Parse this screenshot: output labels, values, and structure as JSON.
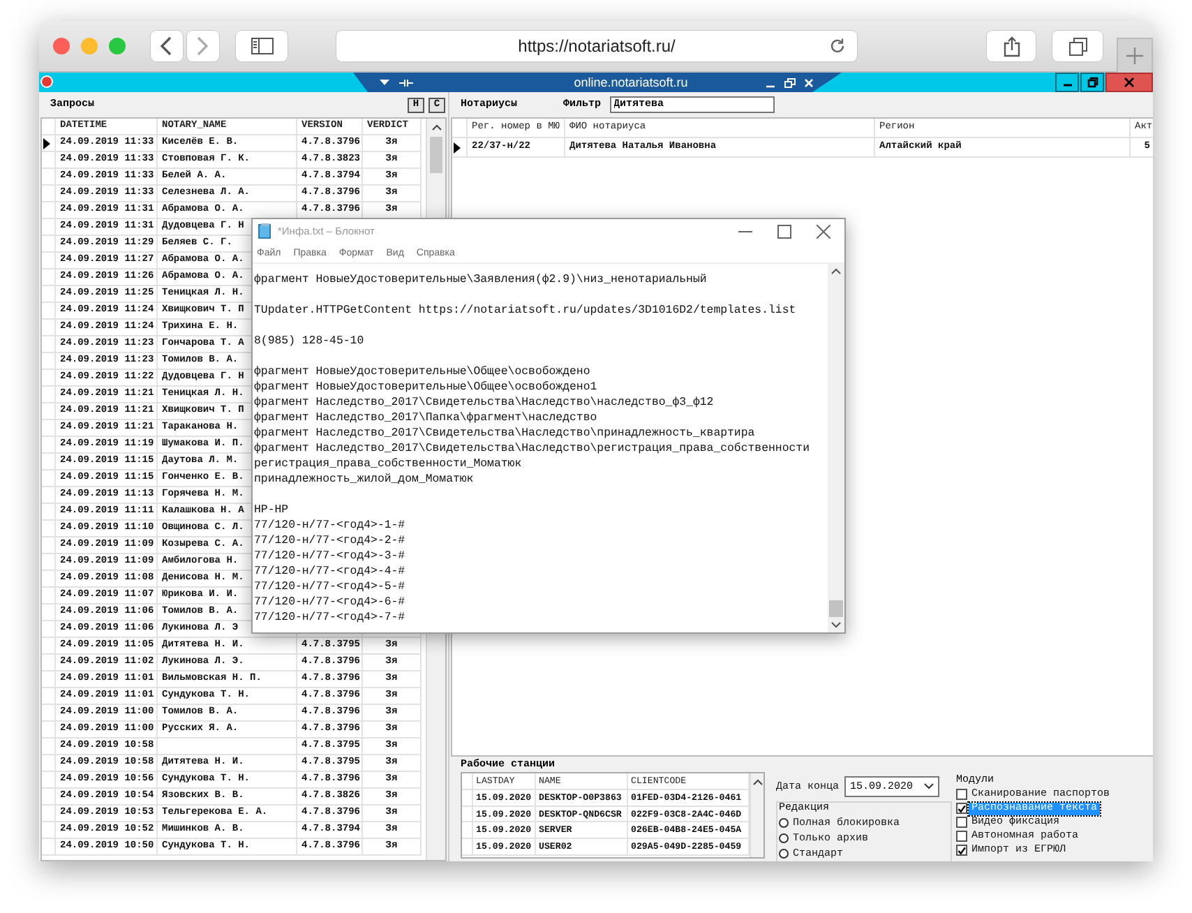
{
  "browser": {
    "url": "https://notariatsoft.ru/"
  },
  "app": {
    "title": "online.notariatsoft.ru"
  },
  "requests": {
    "title": "Запросы",
    "buttons": [
      "Н",
      "С"
    ],
    "columns": [
      "DATETIME",
      "NOTARY_NAME",
      "VERSION",
      "VERDICT"
    ],
    "rows": [
      {
        "datetime": "24.09.2019 11:33",
        "name": "Киселёв Е. В.",
        "version": "4.7.8.3796",
        "verdict": "Зя",
        "selected": true
      },
      {
        "datetime": "24.09.2019 11:33",
        "name": "Стовповая Г. К.",
        "version": "4.7.8.3823",
        "verdict": "Зя",
        "selected": false
      },
      {
        "datetime": "24.09.2019 11:33",
        "name": "Белей А. А.",
        "version": "4.7.8.3794",
        "verdict": "Зя",
        "selected": false
      },
      {
        "datetime": "24.09.2019 11:33",
        "name": "Селезнева Л. А.",
        "version": "4.7.8.3796",
        "verdict": "Зя",
        "selected": false
      },
      {
        "datetime": "24.09.2019 11:31",
        "name": "Абрамова О. А.",
        "version": "4.7.8.3796",
        "verdict": "Зя",
        "selected": false
      },
      {
        "datetime": "24.09.2019 11:31",
        "name": "Дудовцева Г. Н",
        "selected": false
      },
      {
        "datetime": "24.09.2019 11:29",
        "name": "Беляев С. Г.",
        "selected": false
      },
      {
        "datetime": "24.09.2019 11:27",
        "name": "Абрамова О. А.",
        "selected": false
      },
      {
        "datetime": "24.09.2019 11:26",
        "name": "Абрамова О. А.",
        "selected": false
      },
      {
        "datetime": "24.09.2019 11:25",
        "name": "Теницкая Л. Н.",
        "selected": false
      },
      {
        "datetime": "24.09.2019 11:24",
        "name": "Хвищкович Т. П",
        "selected": false
      },
      {
        "datetime": "24.09.2019 11:24",
        "name": "Трихина Е. Н.",
        "selected": false
      },
      {
        "datetime": "24.09.2019 11:23",
        "name": "Гончарова Т. А",
        "selected": false
      },
      {
        "datetime": "24.09.2019 11:23",
        "name": "Томилов В. А.",
        "selected": false
      },
      {
        "datetime": "24.09.2019 11:22",
        "name": "Дудовцева Г. Н",
        "selected": false
      },
      {
        "datetime": "24.09.2019 11:21",
        "name": "Теницкая Л. Н.",
        "selected": false
      },
      {
        "datetime": "24.09.2019 11:21",
        "name": "Хвищкович Т. П",
        "selected": false
      },
      {
        "datetime": "24.09.2019 11:21",
        "name": "Тараканова Н.",
        "selected": false
      },
      {
        "datetime": "24.09.2019 11:19",
        "name": "Шумакова И. П.",
        "selected": false
      },
      {
        "datetime": "24.09.2019 11:15",
        "name": "Даутова Л. М.",
        "selected": false
      },
      {
        "datetime": "24.09.2019 11:15",
        "name": "Гонченко Е. В.",
        "selected": false
      },
      {
        "datetime": "24.09.2019 11:13",
        "name": "Горячева Н. М.",
        "selected": false
      },
      {
        "datetime": "24.09.2019 11:11",
        "name": "Калашкова Н. А",
        "selected": false
      },
      {
        "datetime": "24.09.2019 11:10",
        "name": "Овщинова С. Л.",
        "selected": false
      },
      {
        "datetime": "24.09.2019 11:09",
        "name": "Козырева С. А.",
        "selected": false
      },
      {
        "datetime": "24.09.2019 11:09",
        "name": "Амбилогова Н.",
        "selected": false
      },
      {
        "datetime": "24.09.2019 11:08",
        "name": "Денисова Н. М.",
        "selected": false
      },
      {
        "datetime": "24.09.2019 11:07",
        "name": "Юрикова И. И.",
        "selected": false
      },
      {
        "datetime": "24.09.2019 11:06",
        "name": "Томилов В. А.",
        "selected": false
      },
      {
        "datetime": "24.09.2019 11:06",
        "name": "Лукинова Л. Э",
        "selected": false
      },
      {
        "datetime": "24.09.2019 11:05",
        "name": "Дитятева Н. И.",
        "version": "4.7.8.3795",
        "verdict": "Зя",
        "selected": false
      },
      {
        "datetime": "24.09.2019 11:02",
        "name": "Лукинова Л. Э.",
        "version": "4.7.8.3796",
        "verdict": "Зя",
        "selected": false
      },
      {
        "datetime": "24.09.2019 11:01",
        "name": "Вильмовская Н. П.",
        "version": "4.7.8.3796",
        "verdict": "Зя",
        "selected": false
      },
      {
        "datetime": "24.09.2019 11:01",
        "name": "Сундукова Т. Н.",
        "version": "4.7.8.3796",
        "verdict": "Зя",
        "selected": false
      },
      {
        "datetime": "24.09.2019 11:00",
        "name": "Томилов В. А.",
        "version": "4.7.8.3796",
        "verdict": "Зя",
        "selected": false
      },
      {
        "datetime": "24.09.2019 11:00",
        "name": "Русских Я. А.",
        "version": "4.7.8.3796",
        "verdict": "Зя",
        "selected": false
      },
      {
        "datetime": "24.09.2019 10:58",
        "version": "4.7.8.3795",
        "verdict": "Зя",
        "selected": false
      },
      {
        "datetime": "24.09.2019 10:58",
        "name": "Дитятева Н. И.",
        "version": "4.7.8.3795",
        "verdict": "Зя",
        "selected": false
      },
      {
        "datetime": "24.09.2019 10:56",
        "name": "Сундукова Т. Н.",
        "version": "4.7.8.3796",
        "verdict": "Зя",
        "selected": false
      },
      {
        "datetime": "24.09.2019 10:54",
        "name": "Язовских В. В.",
        "version": "4.7.8.3826",
        "verdict": "Зя",
        "selected": false
      },
      {
        "datetime": "24.09.2019 10:53",
        "name": "Тельгерекова Е. А.",
        "version": "4.7.8.3796",
        "verdict": "Зя",
        "selected": false
      },
      {
        "datetime": "24.09.2019 10:52",
        "name": "Мишинков А. В.",
        "version": "4.7.8.3794",
        "verdict": "Зя",
        "selected": false
      },
      {
        "datetime": "24.09.2019 10:50",
        "name": "Сундукова Т. Н.",
        "version": "4.7.8.3796",
        "verdict": "Зя",
        "selected": false
      }
    ]
  },
  "notaries": {
    "title": "Нотариусы",
    "filter_label": "Фильтр",
    "filter_value": "Дитятева",
    "columns": [
      "Рег. номер в МЮ",
      "ФИО нотариуса",
      "Регион",
      "Акт"
    ],
    "rows": [
      {
        "reg": "22/37-н/22",
        "name": "Дитятева Наталья Ивановна",
        "region": "Алтайский край",
        "act": "5",
        "selected": true
      }
    ]
  },
  "workstations": {
    "title": "Рабочие станции",
    "columns": [
      "LASTDAY",
      "NAME",
      "CLIENTCODE"
    ],
    "rows": [
      {
        "lastday": "15.09.2020",
        "name": "DESKTOP-O0P3863",
        "code": "01FED-03D4-2126-0461"
      },
      {
        "lastday": "15.09.2020",
        "name": "DESKTOP-QND6CSR",
        "code": "022F9-03C8-2A4C-046D"
      },
      {
        "lastday": "15.09.2020",
        "name": "SERVER",
        "code": "026EB-04B8-24E5-045A"
      },
      {
        "lastday": "15.09.2020",
        "name": "USER02",
        "code": "029A5-049D-2285-0459"
      }
    ]
  },
  "end_date": {
    "label": "Дата конца",
    "value": "15.09.2020"
  },
  "edition": {
    "title": "Редакция",
    "options": [
      {
        "label": "Полная блокировка",
        "selected": false
      },
      {
        "label": "Только архив",
        "selected": false
      },
      {
        "label": "Стандарт",
        "selected": false
      }
    ]
  },
  "modules": {
    "title": "Модули",
    "items": [
      {
        "label": "Сканирование паспортов",
        "checked": false,
        "selected": false
      },
      {
        "label": "Распознавание текста",
        "checked": true,
        "selected": true
      },
      {
        "label": "Видео фиксация",
        "checked": false,
        "selected": false
      },
      {
        "label": "Автономная работа",
        "checked": false,
        "selected": false
      },
      {
        "label": "Импорт из ЕГРЮЛ",
        "checked": true,
        "selected": false
      }
    ]
  },
  "notepad": {
    "title": "*Инфа.txt – Блокнот",
    "menu": [
      "Файл",
      "Правка",
      "Формат",
      "Вид",
      "Справка"
    ],
    "paragraphs": [
      [
        "фрагмент НовыеУдостоверительные\\Заявления(ф2.9)\\низ_ненотариальный"
      ],
      [
        "TUpdater.HTTPGetContent https://notariatsoft.ru/updates/3D1016D2/templates.list"
      ],
      [
        "8(985) 128-45-10"
      ],
      [
        "фрагмент НовыеУдостоверительные\\Общее\\освобождено",
        "фрагмент НовыеУдостоверительные\\Общее\\освобождено1",
        "фрагмент Наследство_2017\\Свидетельства\\Наследство\\наследство_ф3_ф12",
        "фрагмент Наследство_2017\\Папка\\фрагмент\\наследство",
        "фрагмент Наследство_2017\\Свидетельства\\Наследство\\принадлежность_квартира",
        "фрагмент Наследство_2017\\Свидетельства\\Наследство\\регистрация_права_собственности",
        "регистрация_права_собственности_Моматюк",
        "принадлежность_жилой_дом_Моматюк"
      ],
      [
        "НР-НР",
        "77/120-н/77-<год4>-1-#",
        "77/120-н/77-<год4>-2-#",
        "77/120-н/77-<год4>-3-#",
        "77/120-н/77-<год4>-4-#",
        "77/120-н/77-<год4>-5-#",
        "77/120-н/77-<год4>-6-#",
        "77/120-н/77-<год4>-7-#"
      ]
    ]
  }
}
